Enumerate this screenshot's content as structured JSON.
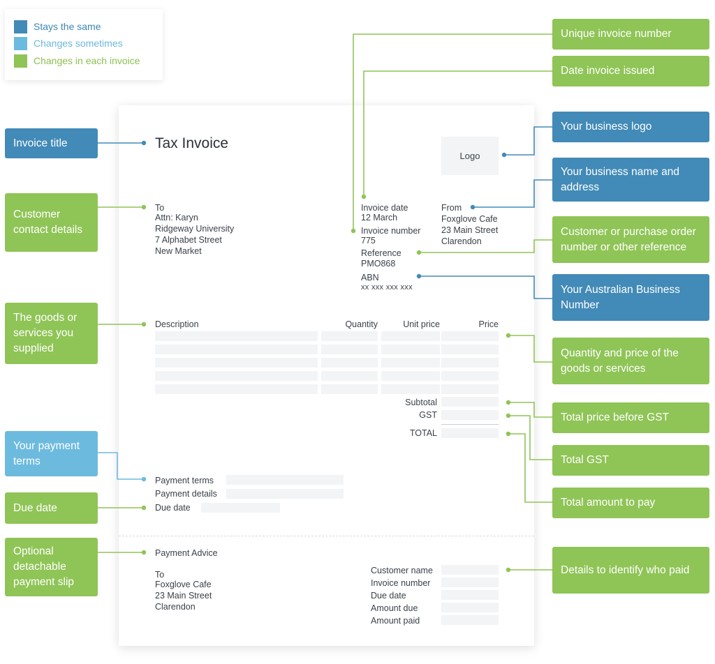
{
  "colors": {
    "stays_same": "#428ab7",
    "changes_sometimes": "#6dbadf",
    "changes_each": "#8fc456"
  },
  "legend": {
    "items": [
      {
        "label": "Stays the same",
        "category": "stays_same",
        "color": "#428ab7",
        "text_color": "#3d86b3"
      },
      {
        "label": "Changes sometimes",
        "category": "changes_sometimes",
        "color": "#6dbadf",
        "text_color": "#6cb8dc"
      },
      {
        "label": "Changes in each invoice",
        "category": "changes_each",
        "color": "#8fc456",
        "text_color": "#8cc152"
      }
    ]
  },
  "invoice": {
    "title": "Tax Invoice",
    "logo": "Logo",
    "to": {
      "heading": "To",
      "lines": [
        "Attn: Karyn",
        "Ridgeway University",
        "7 Alphabet Street",
        "New Market"
      ]
    },
    "meta": {
      "invoice_date_label": "Invoice date",
      "invoice_date_value": "12 March",
      "invoice_number_label": "Invoice number",
      "invoice_number_value": "775",
      "reference_label": "Reference",
      "reference_value": "PMO868",
      "abn_label": "ABN",
      "abn_value": "xx xxx xxx xxx"
    },
    "from": {
      "heading": "From",
      "lines": [
        "Foxglove Cafe",
        "23 Main Street",
        "Clarendon"
      ]
    },
    "table": {
      "headers": [
        "Description",
        "Quantity",
        "Unit price",
        "Price"
      ],
      "row_count": 5
    },
    "totals": {
      "subtotal_label": "Subtotal",
      "gst_label": "GST",
      "total_label": "TOTAL"
    },
    "payment": {
      "terms_label": "Payment terms",
      "details_label": "Payment details",
      "due_label": "Due date"
    },
    "advice": {
      "heading": "Payment Advice",
      "to_heading": "To",
      "to_lines": [
        "Foxglove Cafe",
        "23 Main Street",
        "Clarendon"
      ],
      "fields": [
        "Customer name",
        "Invoice number",
        "Due date",
        "Amount due",
        "Amount paid"
      ]
    }
  },
  "callouts": {
    "left": [
      {
        "label": "Invoice title",
        "category": "stays_same"
      },
      {
        "label": "Customer contact details",
        "category": "changes_each"
      },
      {
        "label": "The goods or services you supplied",
        "category": "changes_each"
      },
      {
        "label": "Your payment terms",
        "category": "changes_sometimes"
      },
      {
        "label": "Due date",
        "category": "changes_each"
      },
      {
        "label": "Optional detachable payment slip",
        "category": "changes_each"
      }
    ],
    "right": [
      {
        "label": "Unique invoice number",
        "category": "changes_each"
      },
      {
        "label": "Date invoice issued",
        "category": "changes_each"
      },
      {
        "label": "Your business logo",
        "category": "stays_same"
      },
      {
        "label": "Your business name and address",
        "category": "stays_same"
      },
      {
        "label": "Customer or purchase order number or other reference",
        "category": "changes_each"
      },
      {
        "label": "Your Australian Business Number",
        "category": "stays_same"
      },
      {
        "label": "Quantity and price of the goods or services",
        "category": "changes_each"
      },
      {
        "label": "Total price before GST",
        "category": "changes_each"
      },
      {
        "label": "Total GST",
        "category": "changes_each"
      },
      {
        "label": "Total amount to pay",
        "category": "changes_each"
      },
      {
        "label": "Details to identify who paid",
        "category": "changes_each"
      }
    ]
  }
}
